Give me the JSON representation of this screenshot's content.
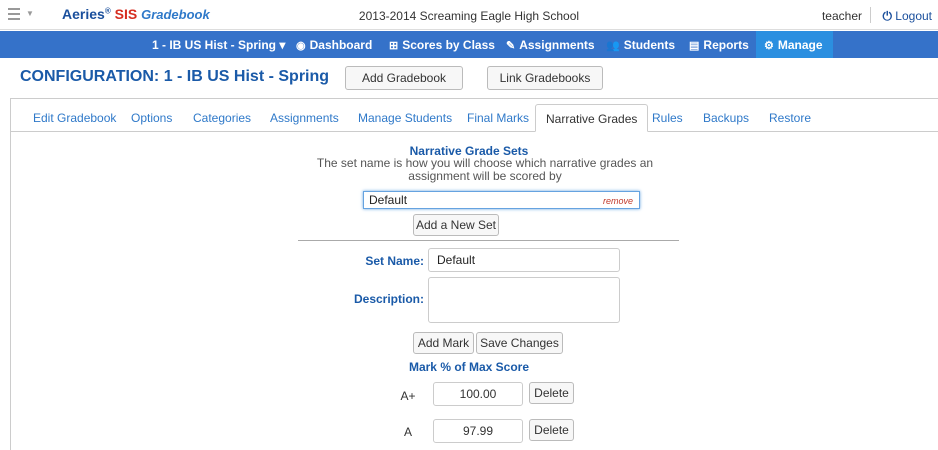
{
  "header": {
    "brand_main": "Aeries",
    "brand_reg": "®",
    "brand_sis": "SIS",
    "brand_gradebook": "Gradebook",
    "school": "2013-2014 Screaming Eagle High School",
    "user": "teacher",
    "logout": "Logout"
  },
  "nav": {
    "gradebook_select": "1 - IB US Hist - Spring",
    "items": [
      "Dashboard",
      "Scores by Class",
      "Assignments",
      "Students",
      "Reports",
      "Manage"
    ]
  },
  "config": {
    "title": "CONFIGURATION: 1 - IB US Hist - Spring",
    "add_gradebook": "Add Gradebook",
    "link_gradebooks": "Link Gradebooks"
  },
  "tabs": [
    "Edit Gradebook",
    "Options",
    "Categories",
    "Assignments",
    "Manage Students",
    "Final Marks",
    "Narrative Grades",
    "Rules",
    "Backups",
    "Restore"
  ],
  "narrative": {
    "title": "Narrative Grade Sets",
    "description": "The set name is how you will choose which narrative grades an assignment will be scored by",
    "set_item": "Default",
    "remove": "remove",
    "add_set": "Add a New Set",
    "set_name_label": "Set Name:",
    "set_name_value": "Default",
    "description_label": "Description:",
    "add_mark": "Add Mark",
    "save_changes": "Save Changes",
    "marks_header": "Mark  % of Max Score",
    "marks": [
      {
        "mark": "A+",
        "score": "100.00",
        "delete": "Delete"
      },
      {
        "mark": "A",
        "score": "97.99",
        "delete": "Delete"
      }
    ]
  },
  "colors": {
    "navbar": "#3572c9",
    "manage_active": "#2b8fe0",
    "title_blue": "#1a5aa8",
    "link_blue": "#2f79c9",
    "remove_red": "#c0392b"
  }
}
